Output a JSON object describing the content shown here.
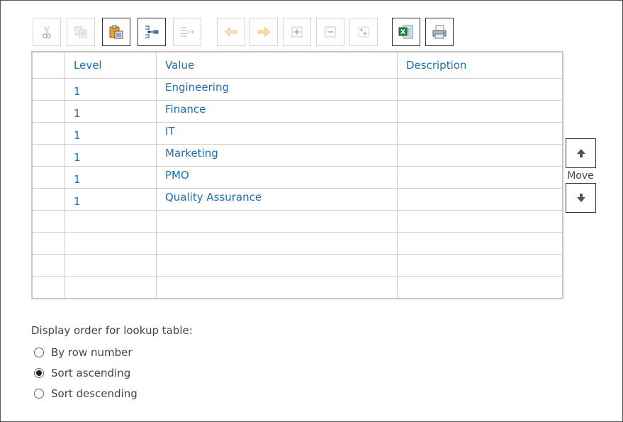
{
  "toolbar": {
    "buttons": [
      {
        "name": "cut",
        "icon": "scissors-icon",
        "enabled": false
      },
      {
        "name": "copy",
        "icon": "copy-icon",
        "enabled": false
      },
      {
        "name": "paste",
        "icon": "paste-icon",
        "enabled": true
      },
      {
        "name": "insert-row",
        "icon": "insert-row-icon",
        "enabled": true
      },
      {
        "name": "indent",
        "icon": "indent-icon",
        "enabled": false
      },
      {
        "name": "outdent-left",
        "icon": "arrow-left-icon",
        "enabled": false
      },
      {
        "name": "indent-right",
        "icon": "arrow-right-icon",
        "enabled": false
      },
      {
        "name": "expand",
        "icon": "plus-icon",
        "enabled": false
      },
      {
        "name": "collapse",
        "icon": "minus-icon",
        "enabled": false
      },
      {
        "name": "expand-all",
        "icon": "expand-all-icon",
        "enabled": false
      },
      {
        "name": "export-excel",
        "icon": "excel-icon",
        "enabled": true
      },
      {
        "name": "print",
        "icon": "printer-icon",
        "enabled": true
      }
    ]
  },
  "table": {
    "headers": [
      "",
      "Level",
      "Value",
      "Description"
    ],
    "rows": [
      {
        "level": "1",
        "value": "Engineering",
        "description": ""
      },
      {
        "level": "1",
        "value": "Finance",
        "description": ""
      },
      {
        "level": "1",
        "value": "IT",
        "description": ""
      },
      {
        "level": "1",
        "value": "Marketing",
        "description": ""
      },
      {
        "level": "1",
        "value": "PMO",
        "description": ""
      },
      {
        "level": "1",
        "value": "Quality Assurance",
        "description": ""
      },
      {
        "level": "",
        "value": "",
        "description": ""
      },
      {
        "level": "",
        "value": "",
        "description": ""
      },
      {
        "level": "",
        "value": "",
        "description": ""
      },
      {
        "level": "",
        "value": "",
        "description": ""
      }
    ]
  },
  "move": {
    "label": "Move",
    "up_icon": "arrow-up-icon",
    "down_icon": "arrow-down-icon"
  },
  "display_order": {
    "title": "Display order for lookup table:",
    "options": [
      {
        "label": "By row number",
        "checked": false
      },
      {
        "label": "Sort ascending",
        "checked": true
      },
      {
        "label": "Sort descending",
        "checked": false
      }
    ]
  },
  "colors": {
    "link_blue": "#1f6fb4",
    "grid_border": "#d0d0d0",
    "text": "#444444"
  }
}
